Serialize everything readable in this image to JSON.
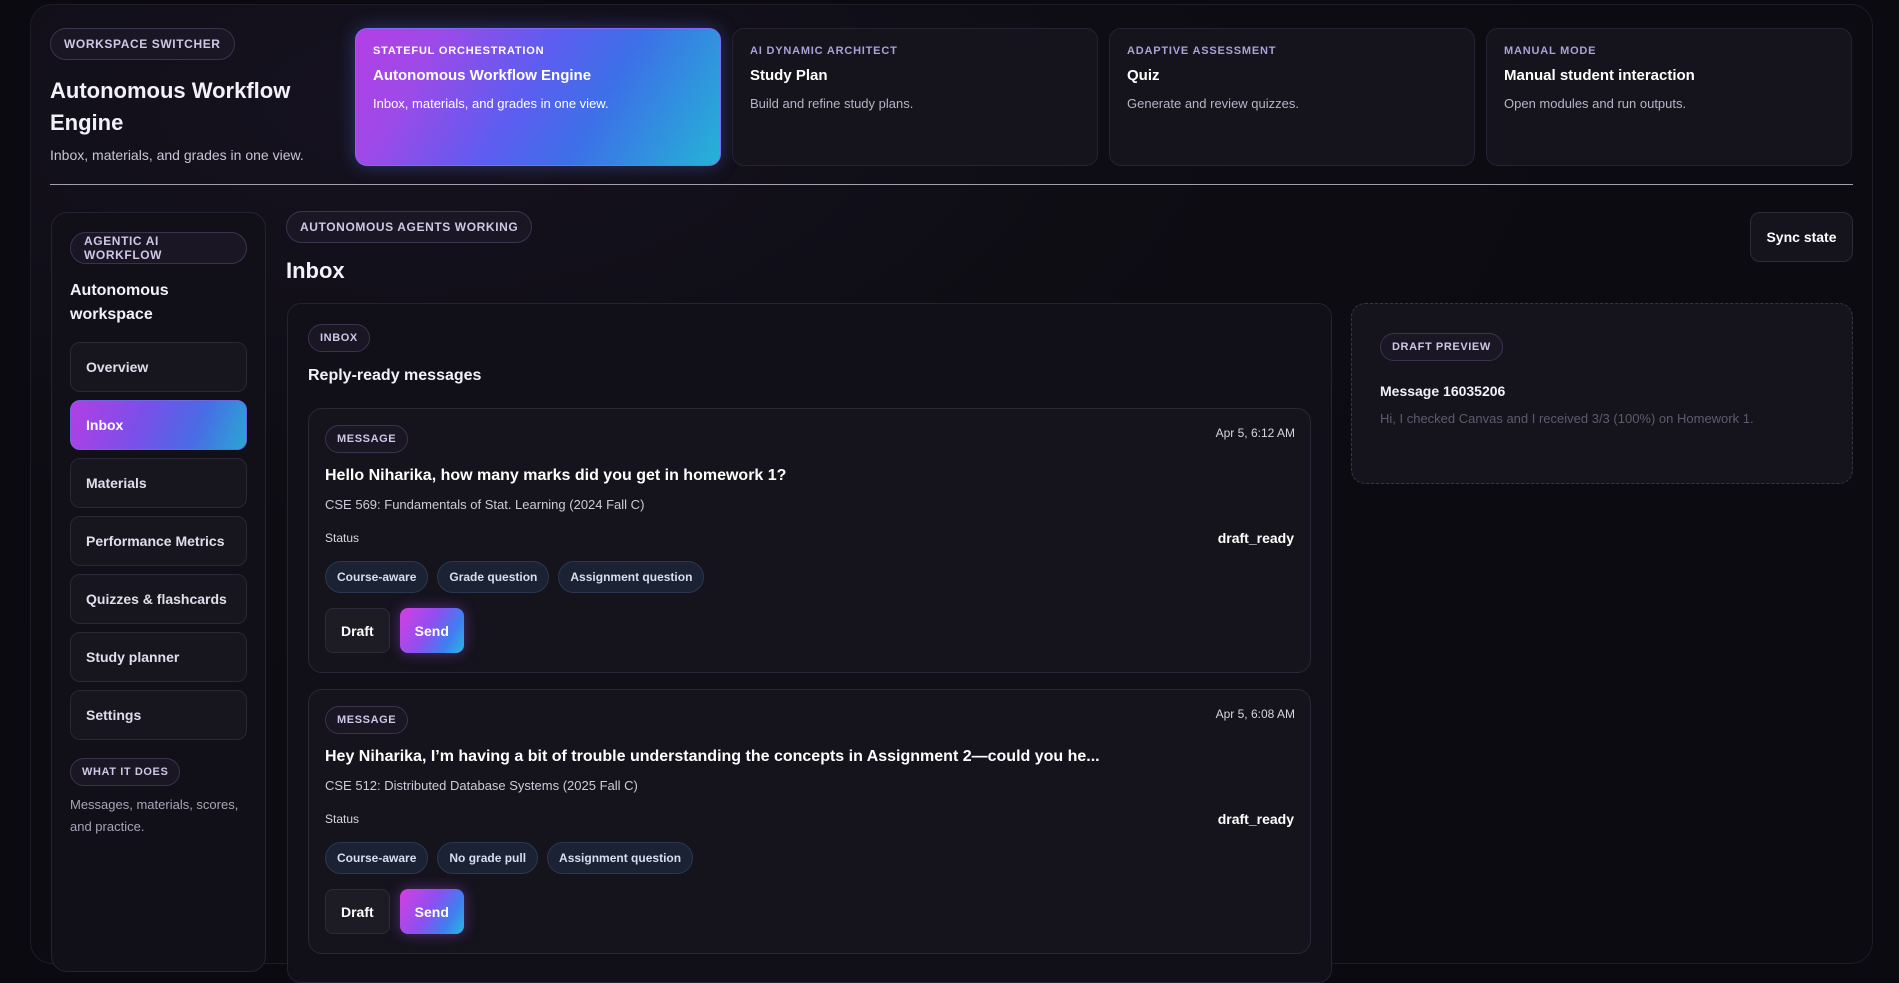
{
  "header": {
    "switcher_label": "WORKSPACE SWITCHER",
    "title": "Autonomous Workflow Engine",
    "subtitle": "Inbox, materials, and grades in one view.",
    "modes": [
      {
        "eyebrow": "STATEFUL ORCHESTRATION",
        "title": "Autonomous Workflow Engine",
        "desc": "Inbox, materials, and grades in one view.",
        "active": true
      },
      {
        "eyebrow": "AI DYNAMIC ARCHITECT",
        "title": "Study Plan",
        "desc": "Build and refine study plans."
      },
      {
        "eyebrow": "ADAPTIVE ASSESSMENT",
        "title": "Quiz",
        "desc": "Generate and review quizzes."
      },
      {
        "eyebrow": "MANUAL MODE",
        "title": "Manual student interaction",
        "desc": "Open modules and run outputs."
      }
    ]
  },
  "sidebar": {
    "badge": "AGENTIC AI WORKFLOW",
    "title": "Autonomous workspace",
    "items": [
      {
        "label": "Overview"
      },
      {
        "label": "Inbox",
        "active": true
      },
      {
        "label": "Materials"
      },
      {
        "label": "Performance Metrics"
      },
      {
        "label": "Quizzes & flashcards"
      },
      {
        "label": "Study planner"
      },
      {
        "label": "Settings"
      }
    ],
    "what_badge": "WHAT IT DOES",
    "what_text": "Messages, materials, scores, and practice."
  },
  "main": {
    "badge": "AUTONOMOUS AGENTS WORKING",
    "title": "Inbox",
    "sync_label": "Sync state",
    "panel_badge": "INBOX",
    "panel_title": "Reply-ready messages",
    "messages": [
      {
        "badge": "MESSAGE",
        "date": "Apr 5, 6:12 AM",
        "subject": "Hello Niharika, how many marks did you get in homework 1?",
        "course": "CSE 569: Fundamentals of Stat. Learning (2024 Fall C)",
        "status_label": "Status",
        "status": "draft_ready",
        "tags": [
          "Course-aware",
          "Grade question",
          "Assignment question"
        ],
        "draft_label": "Draft",
        "send_label": "Send"
      },
      {
        "badge": "MESSAGE",
        "date": "Apr 5, 6:08 AM",
        "subject": "Hey Niharika, I’m having a bit of trouble understanding the concepts in Assignment 2—could you he...",
        "course": "CSE 512: Distributed Database Systems (2025 Fall C)",
        "status_label": "Status",
        "status": "draft_ready",
        "tags": [
          "Course-aware",
          "No grade pull",
          "Assignment question"
        ],
        "draft_label": "Draft",
        "send_label": "Send"
      }
    ]
  },
  "preview": {
    "badge": "DRAFT PREVIEW",
    "title": "Message 16035206",
    "body": "Hi, I checked Canvas and I received 3/3 (100%) on Homework 1."
  },
  "colors": {
    "background": "#0b0a10",
    "accent_gradient_start": "#b43fe6",
    "accent_gradient_end": "#25b3d6"
  }
}
